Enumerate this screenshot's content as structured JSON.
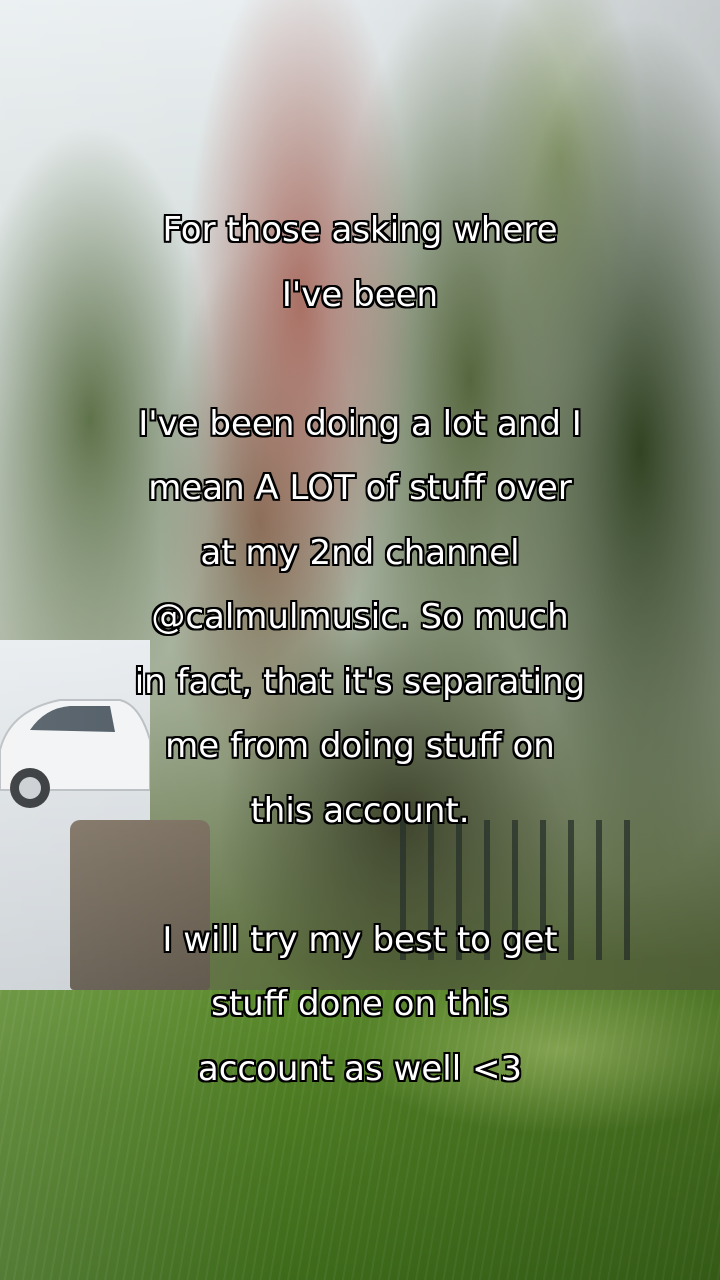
{
  "caption": {
    "lines": [
      "For those asking where",
      "I've been",
      "",
      "I've been doing a lot and I",
      "mean A LOT of stuff over",
      "at my 2nd channel",
      "@calmulmusic. So much",
      "in fact, that it's separating",
      "me from doing stuff on",
      "this account.",
      "",
      "I will try my best to get",
      "stuff done on this",
      "account as well <3"
    ]
  },
  "colors": {
    "caption_text": "#ffffff",
    "caption_outline": "#000000"
  }
}
